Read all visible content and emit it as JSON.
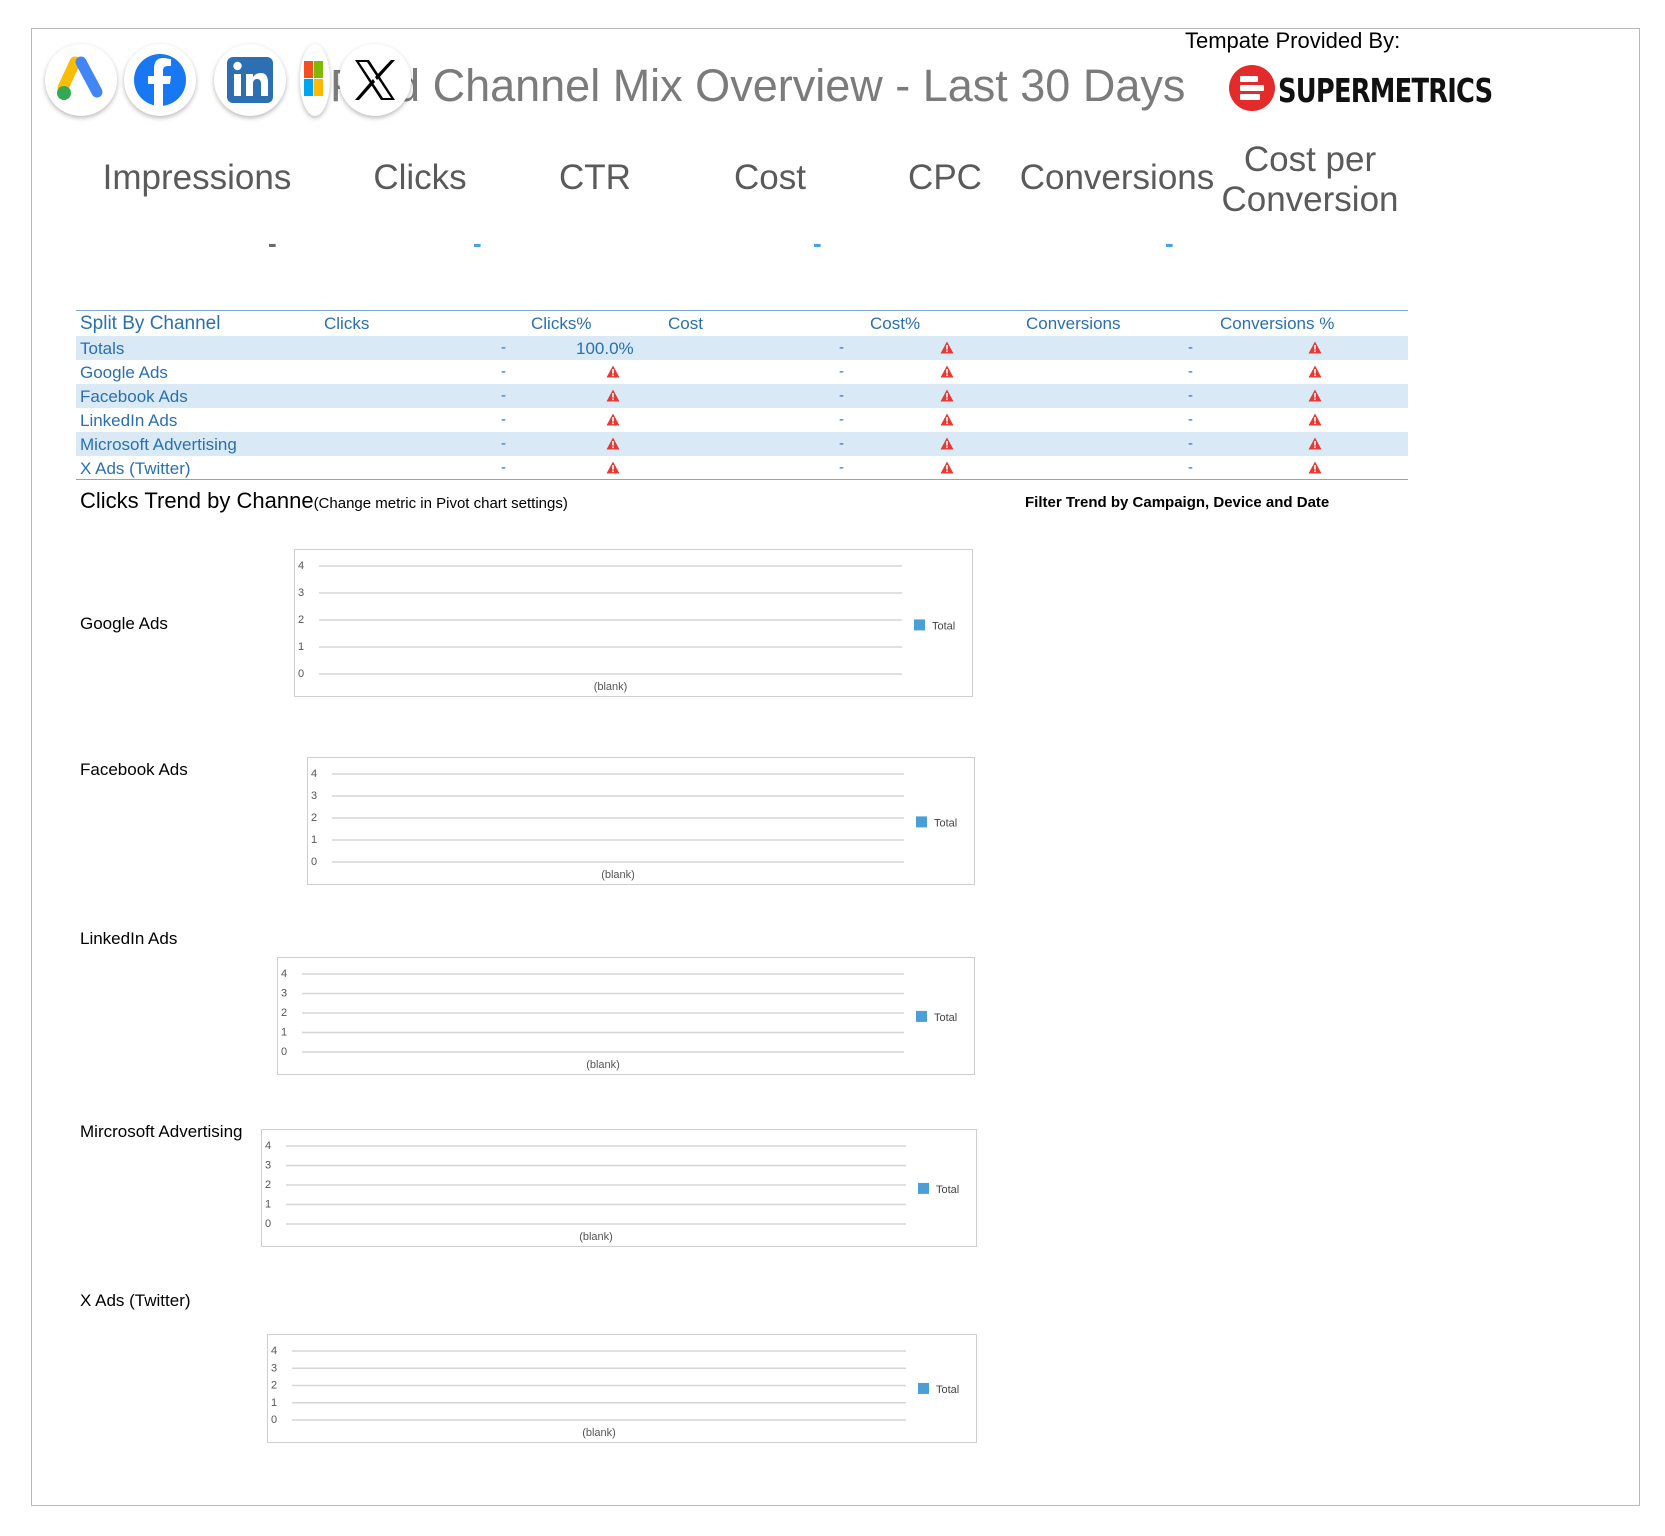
{
  "header": {
    "title": "Paid Channel Mix Overview - Last 30 Days",
    "provided_by": "Tempate Provided By:",
    "brand": "SUPERMETRICS",
    "logos": [
      "google-ads-icon",
      "facebook-icon",
      "linkedin-icon",
      "microsoft-icon",
      "x-icon"
    ]
  },
  "kpis": [
    {
      "label": "Impressions",
      "value": "-"
    },
    {
      "label": "Clicks",
      "value": "-"
    },
    {
      "label": "CTR",
      "value": ""
    },
    {
      "label": "Cost",
      "value": "-"
    },
    {
      "label": "CPC",
      "value": ""
    },
    {
      "label": "Conversions",
      "value": "-"
    },
    {
      "label": "Cost per Conversion",
      "value": ""
    }
  ],
  "channel_table": {
    "headers": [
      "Split By Channel",
      "Clicks",
      "Clicks%",
      "Cost",
      "Cost%",
      "Conversions",
      "Conversions %"
    ],
    "rows": [
      {
        "channel": "Totals",
        "clicks": "-",
        "clicks_pct": "100.0%",
        "cost": "-",
        "cost_pct": "warning",
        "conversions": "-",
        "conversions_pct": "warning"
      },
      {
        "channel": "Google Ads",
        "clicks": "-",
        "clicks_pct": "warning",
        "cost": "-",
        "cost_pct": "warning",
        "conversions": "-",
        "conversions_pct": "warning"
      },
      {
        "channel": "Facebook Ads",
        "clicks": "-",
        "clicks_pct": "warning",
        "cost": "-",
        "cost_pct": "warning",
        "conversions": "-",
        "conversions_pct": "warning"
      },
      {
        "channel": "LinkedIn Ads",
        "clicks": "-",
        "clicks_pct": "warning",
        "cost": "-",
        "cost_pct": "warning",
        "conversions": "-",
        "conversions_pct": "warning"
      },
      {
        "channel": "Microsoft Advertising",
        "clicks": "-",
        "clicks_pct": "warning",
        "cost": "-",
        "cost_pct": "warning",
        "conversions": "-",
        "conversions_pct": "warning"
      },
      {
        "channel": "X Ads (Twitter)",
        "clicks": "-",
        "clicks_pct": "warning",
        "cost": "-",
        "cost_pct": "warning",
        "conversions": "-",
        "conversions_pct": "warning"
      }
    ]
  },
  "trend": {
    "title": "Clicks Trend by Channe",
    "note": "(Change metric in Pivot chart settings)",
    "filter_note": "Filter Trend by Campaign, Device and Date",
    "channel_labels": [
      "Google Ads",
      "Facebook Ads",
      "LinkedIn Ads",
      "Mircrosoft Advertising",
      "X Ads (Twitter)"
    ]
  },
  "colors": {
    "accent_blue": "#2a6fb0",
    "band": "#d9eaf6",
    "legend_blue": "#4a9fd6",
    "warning_red": "#e53935",
    "kpi_dash_blue": "#4aa3df"
  },
  "chart_data": [
    {
      "type": "bar",
      "categories": [
        "(blank)"
      ],
      "series": [
        {
          "name": "Total",
          "values": []
        }
      ],
      "ylim": [
        0,
        4
      ],
      "yticks": [
        0,
        1,
        2,
        3,
        4
      ],
      "legend": "right"
    },
    {
      "type": "bar",
      "categories": [
        "(blank)"
      ],
      "series": [
        {
          "name": "Total",
          "values": []
        }
      ],
      "ylim": [
        0,
        4
      ],
      "yticks": [
        0,
        1,
        2,
        3,
        4
      ],
      "legend": "right"
    },
    {
      "type": "bar",
      "categories": [
        "(blank)"
      ],
      "series": [
        {
          "name": "Total",
          "values": []
        }
      ],
      "ylim": [
        0,
        4
      ],
      "yticks": [
        0,
        1,
        2,
        3,
        4
      ],
      "legend": "right"
    },
    {
      "type": "bar",
      "categories": [
        "(blank)"
      ],
      "series": [
        {
          "name": "Total",
          "values": []
        }
      ],
      "ylim": [
        0,
        4
      ],
      "yticks": [
        0,
        1,
        2,
        3,
        4
      ],
      "legend": "right"
    },
    {
      "type": "bar",
      "categories": [
        "(blank)"
      ],
      "series": [
        {
          "name": "Total",
          "values": []
        }
      ],
      "ylim": [
        0,
        4
      ],
      "yticks": [
        0,
        1,
        2,
        3,
        4
      ],
      "legend": "right"
    }
  ]
}
